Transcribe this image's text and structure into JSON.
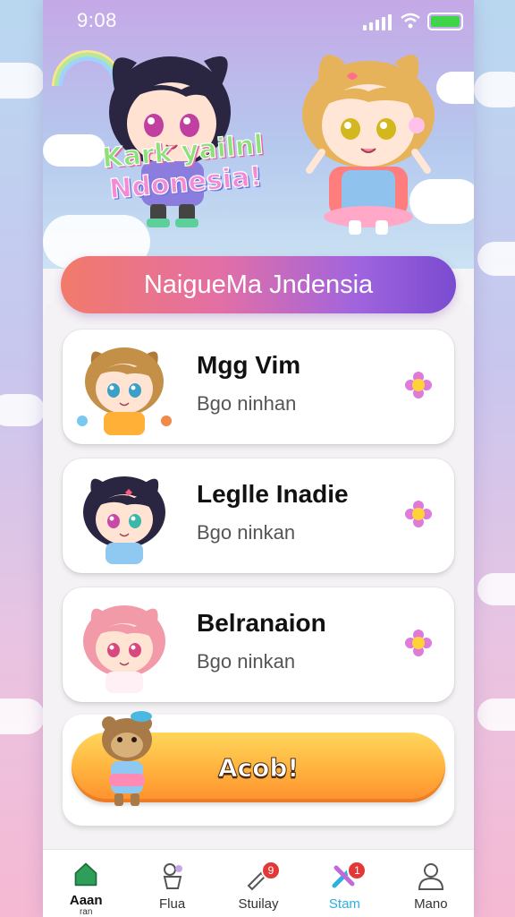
{
  "status_bar": {
    "time": "9:08"
  },
  "header": {
    "title_art_line1": "Kark yailnl",
    "title_art_line2": "Ndonesia!"
  },
  "banner": {
    "title": "NaigueMa Jndensia"
  },
  "cards": [
    {
      "name": "Mgg Vim",
      "subtitle": "Bgo ninhan"
    },
    {
      "name": "Leglle Inadie",
      "subtitle": "Bgo ninkan"
    },
    {
      "name": "Belranaion",
      "subtitle": "Bgo ninkan"
    }
  ],
  "action": {
    "button_label": "Acob!"
  },
  "bottom_nav": [
    {
      "label": "Aaan",
      "sub": "ran",
      "icon": "home-icon",
      "badge": ""
    },
    {
      "label": "Flua",
      "sub": "",
      "icon": "flower-pot-icon",
      "badge": ""
    },
    {
      "label": "Stuilay",
      "sub": "",
      "icon": "brush-icon",
      "badge": "9"
    },
    {
      "label": "Stam",
      "sub": "",
      "icon": "star-tools-icon",
      "badge": "1"
    },
    {
      "label": "Mano",
      "sub": "",
      "icon": "profile-icon",
      "badge": ""
    }
  ],
  "colors": {
    "banner_start": "#f27a6a",
    "banner_end": "#7a4bd0",
    "button": "#ffb13d",
    "battery": "#3fd44a",
    "active_nav": "#2bb0e0"
  }
}
